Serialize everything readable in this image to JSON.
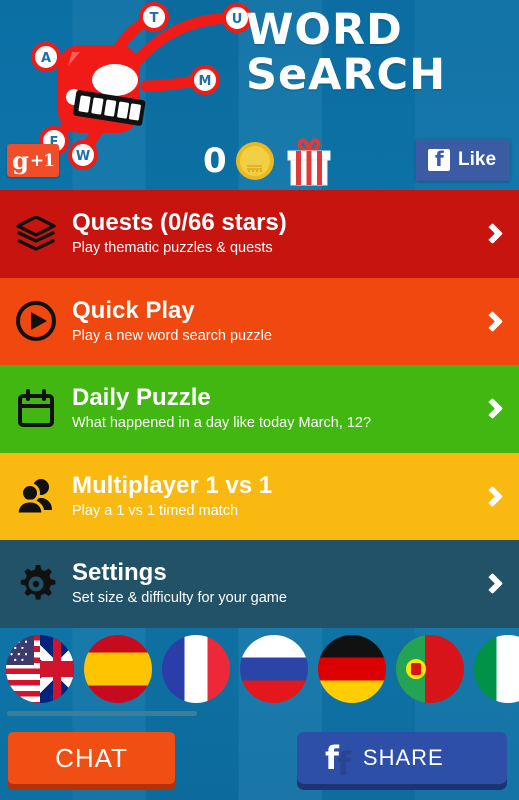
{
  "app": {
    "title_line1": "WORD",
    "title_line2": "SeARCH",
    "background_color": "#0d6ea0"
  },
  "header": {
    "gplus": {
      "g": "g",
      "plus_one": "+1",
      "name": "google-plus-one"
    },
    "currency": {
      "count": "0",
      "coin_icon": "gold-coin-icon",
      "gift_icon": "gift-box-icon"
    },
    "facebook_like": {
      "label": "Like",
      "icon": "facebook-f-icon",
      "color": "#3b5ba5"
    },
    "mascot": {
      "name": "octopus-mascot",
      "color": "#f01b17",
      "letters": [
        "A",
        "T",
        "U",
        "M",
        "W",
        "F"
      ]
    }
  },
  "menu": {
    "rows": [
      {
        "id": "quests",
        "title": "Quests (0/66 stars)",
        "subtitle": "Play thematic puzzles & quests",
        "icon": "layers-icon",
        "color": "#c8140f"
      },
      {
        "id": "quick-play",
        "title": "Quick Play",
        "subtitle": "Play a new word search puzzle",
        "icon": "play-circle-icon",
        "color": "#f0480e"
      },
      {
        "id": "daily-puzzle",
        "title": "Daily Puzzle",
        "subtitle": "What happened in a day like today March, 12?",
        "icon": "calendar-icon",
        "color": "#42b611"
      },
      {
        "id": "multiplayer",
        "title": "Multiplayer 1 vs 1",
        "subtitle": "Play a 1 vs 1 timed match",
        "icon": "people-group-icon",
        "color": "#fab911"
      },
      {
        "id": "settings",
        "title": "Settings",
        "subtitle": "Set size & difficulty for your game",
        "icon": "gear-icon",
        "color": "#215267"
      }
    ],
    "chevron_icon": "chevron-right-icon"
  },
  "languages": {
    "flags": [
      {
        "id": "en",
        "name": "flag-us-uk-icon"
      },
      {
        "id": "es",
        "name": "flag-spain-icon"
      },
      {
        "id": "fr",
        "name": "flag-france-icon"
      },
      {
        "id": "ru",
        "name": "flag-russia-icon"
      },
      {
        "id": "de",
        "name": "flag-germany-icon"
      },
      {
        "id": "pt",
        "name": "flag-portugal-icon"
      },
      {
        "id": "it",
        "name": "flag-italy-icon"
      }
    ]
  },
  "bottom": {
    "chat": {
      "label": "CHAT",
      "color": "#f04e12"
    },
    "share": {
      "label": "SHARE",
      "icon": "facebook-f-icon",
      "color": "#2e4fa8"
    }
  }
}
